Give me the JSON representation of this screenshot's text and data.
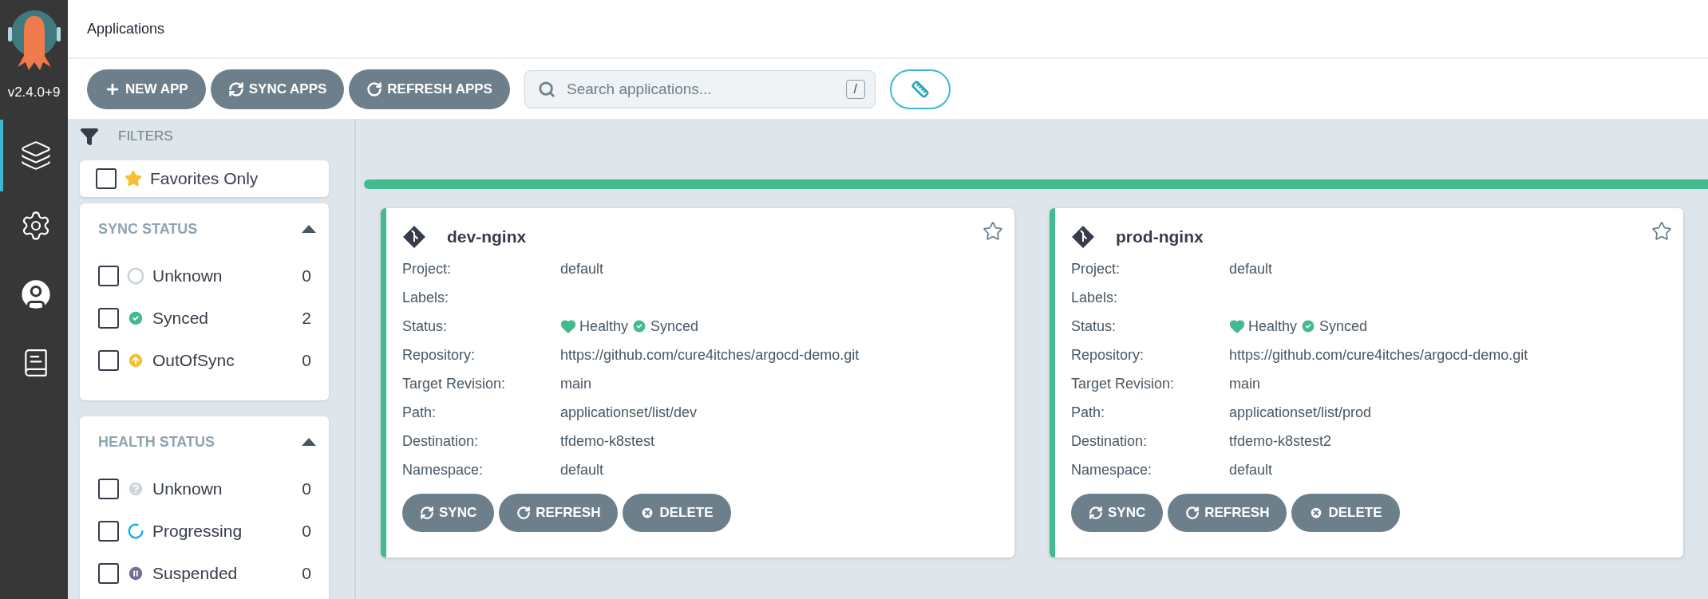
{
  "sidebar": {
    "version": "v2.4.0+9",
    "items": [
      {
        "kind": "layers",
        "selected": true
      },
      {
        "kind": "gears",
        "selected": false
      },
      {
        "kind": "user",
        "selected": false
      },
      {
        "kind": "docs",
        "selected": false
      }
    ]
  },
  "header": {
    "title": "Applications"
  },
  "toolbar": {
    "buttons": [
      {
        "kind": "plus",
        "label": "NEW APP"
      },
      {
        "kind": "sync",
        "label": "SYNC APPS"
      },
      {
        "kind": "refresh",
        "label": "REFRESH APPS"
      }
    ],
    "search": {
      "placeholder": "Search applications...",
      "shortcut": "/"
    }
  },
  "filters": {
    "title": "FILTERS",
    "favorites": {
      "label": "Favorites Only",
      "checked": false
    },
    "groups": [
      {
        "title": "SYNC STATUS",
        "expanded": true,
        "items": [
          {
            "kind": "unknown-sync",
            "label": "Unknown",
            "count": "0",
            "checked": false
          },
          {
            "kind": "synced",
            "label": "Synced",
            "count": "2",
            "checked": false
          },
          {
            "kind": "outofsync",
            "label": "OutOfSync",
            "count": "0",
            "checked": false
          }
        ]
      },
      {
        "title": "HEALTH STATUS",
        "expanded": true,
        "items": [
          {
            "kind": "unknown-health",
            "label": "Unknown",
            "count": "0",
            "checked": false
          },
          {
            "kind": "progressing",
            "label": "Progressing",
            "count": "0",
            "checked": false
          },
          {
            "kind": "suspended",
            "label": "Suspended",
            "count": "0",
            "checked": false
          }
        ]
      }
    ]
  },
  "apps": [
    {
      "name": "dev-nginx",
      "favorite": false,
      "fields": [
        {
          "label": "Project:",
          "value": "default"
        },
        {
          "label": "Labels:"
        },
        {
          "label": "Status:",
          "kind": "status",
          "health": "Healthy",
          "sync": "Synced"
        },
        {
          "label": "Repository:",
          "value": "https://github.com/cure4itches/argocd-demo.git"
        },
        {
          "label": "Target Revision:",
          "value": "main"
        },
        {
          "label": "Path:",
          "value": "applicationset/list/dev"
        },
        {
          "label": "Destination:",
          "value": "tfdemo-k8stest"
        },
        {
          "label": "Namespace:",
          "value": "default"
        }
      ],
      "actions": [
        {
          "kind": "sync",
          "label": "SYNC"
        },
        {
          "kind": "refresh",
          "label": "REFRESH"
        },
        {
          "kind": "delete",
          "label": "DELETE"
        }
      ]
    },
    {
      "name": "prod-nginx",
      "favorite": false,
      "fields": [
        {
          "label": "Project:",
          "value": "default"
        },
        {
          "label": "Labels:"
        },
        {
          "label": "Status:",
          "kind": "status",
          "health": "Healthy",
          "sync": "Synced"
        },
        {
          "label": "Repository:",
          "value": "https://github.com/cure4itches/argocd-demo.git"
        },
        {
          "label": "Target Revision:",
          "value": "main"
        },
        {
          "label": "Path:",
          "value": "applicationset/list/prod"
        },
        {
          "label": "Destination:",
          "value": "tfdemo-k8stest2"
        },
        {
          "label": "Namespace:",
          "value": "default"
        }
      ],
      "actions": [
        {
          "kind": "sync",
          "label": "SYNC"
        },
        {
          "kind": "refresh",
          "label": "REFRESH"
        },
        {
          "kind": "delete",
          "label": "DELETE"
        }
      ]
    }
  ]
}
